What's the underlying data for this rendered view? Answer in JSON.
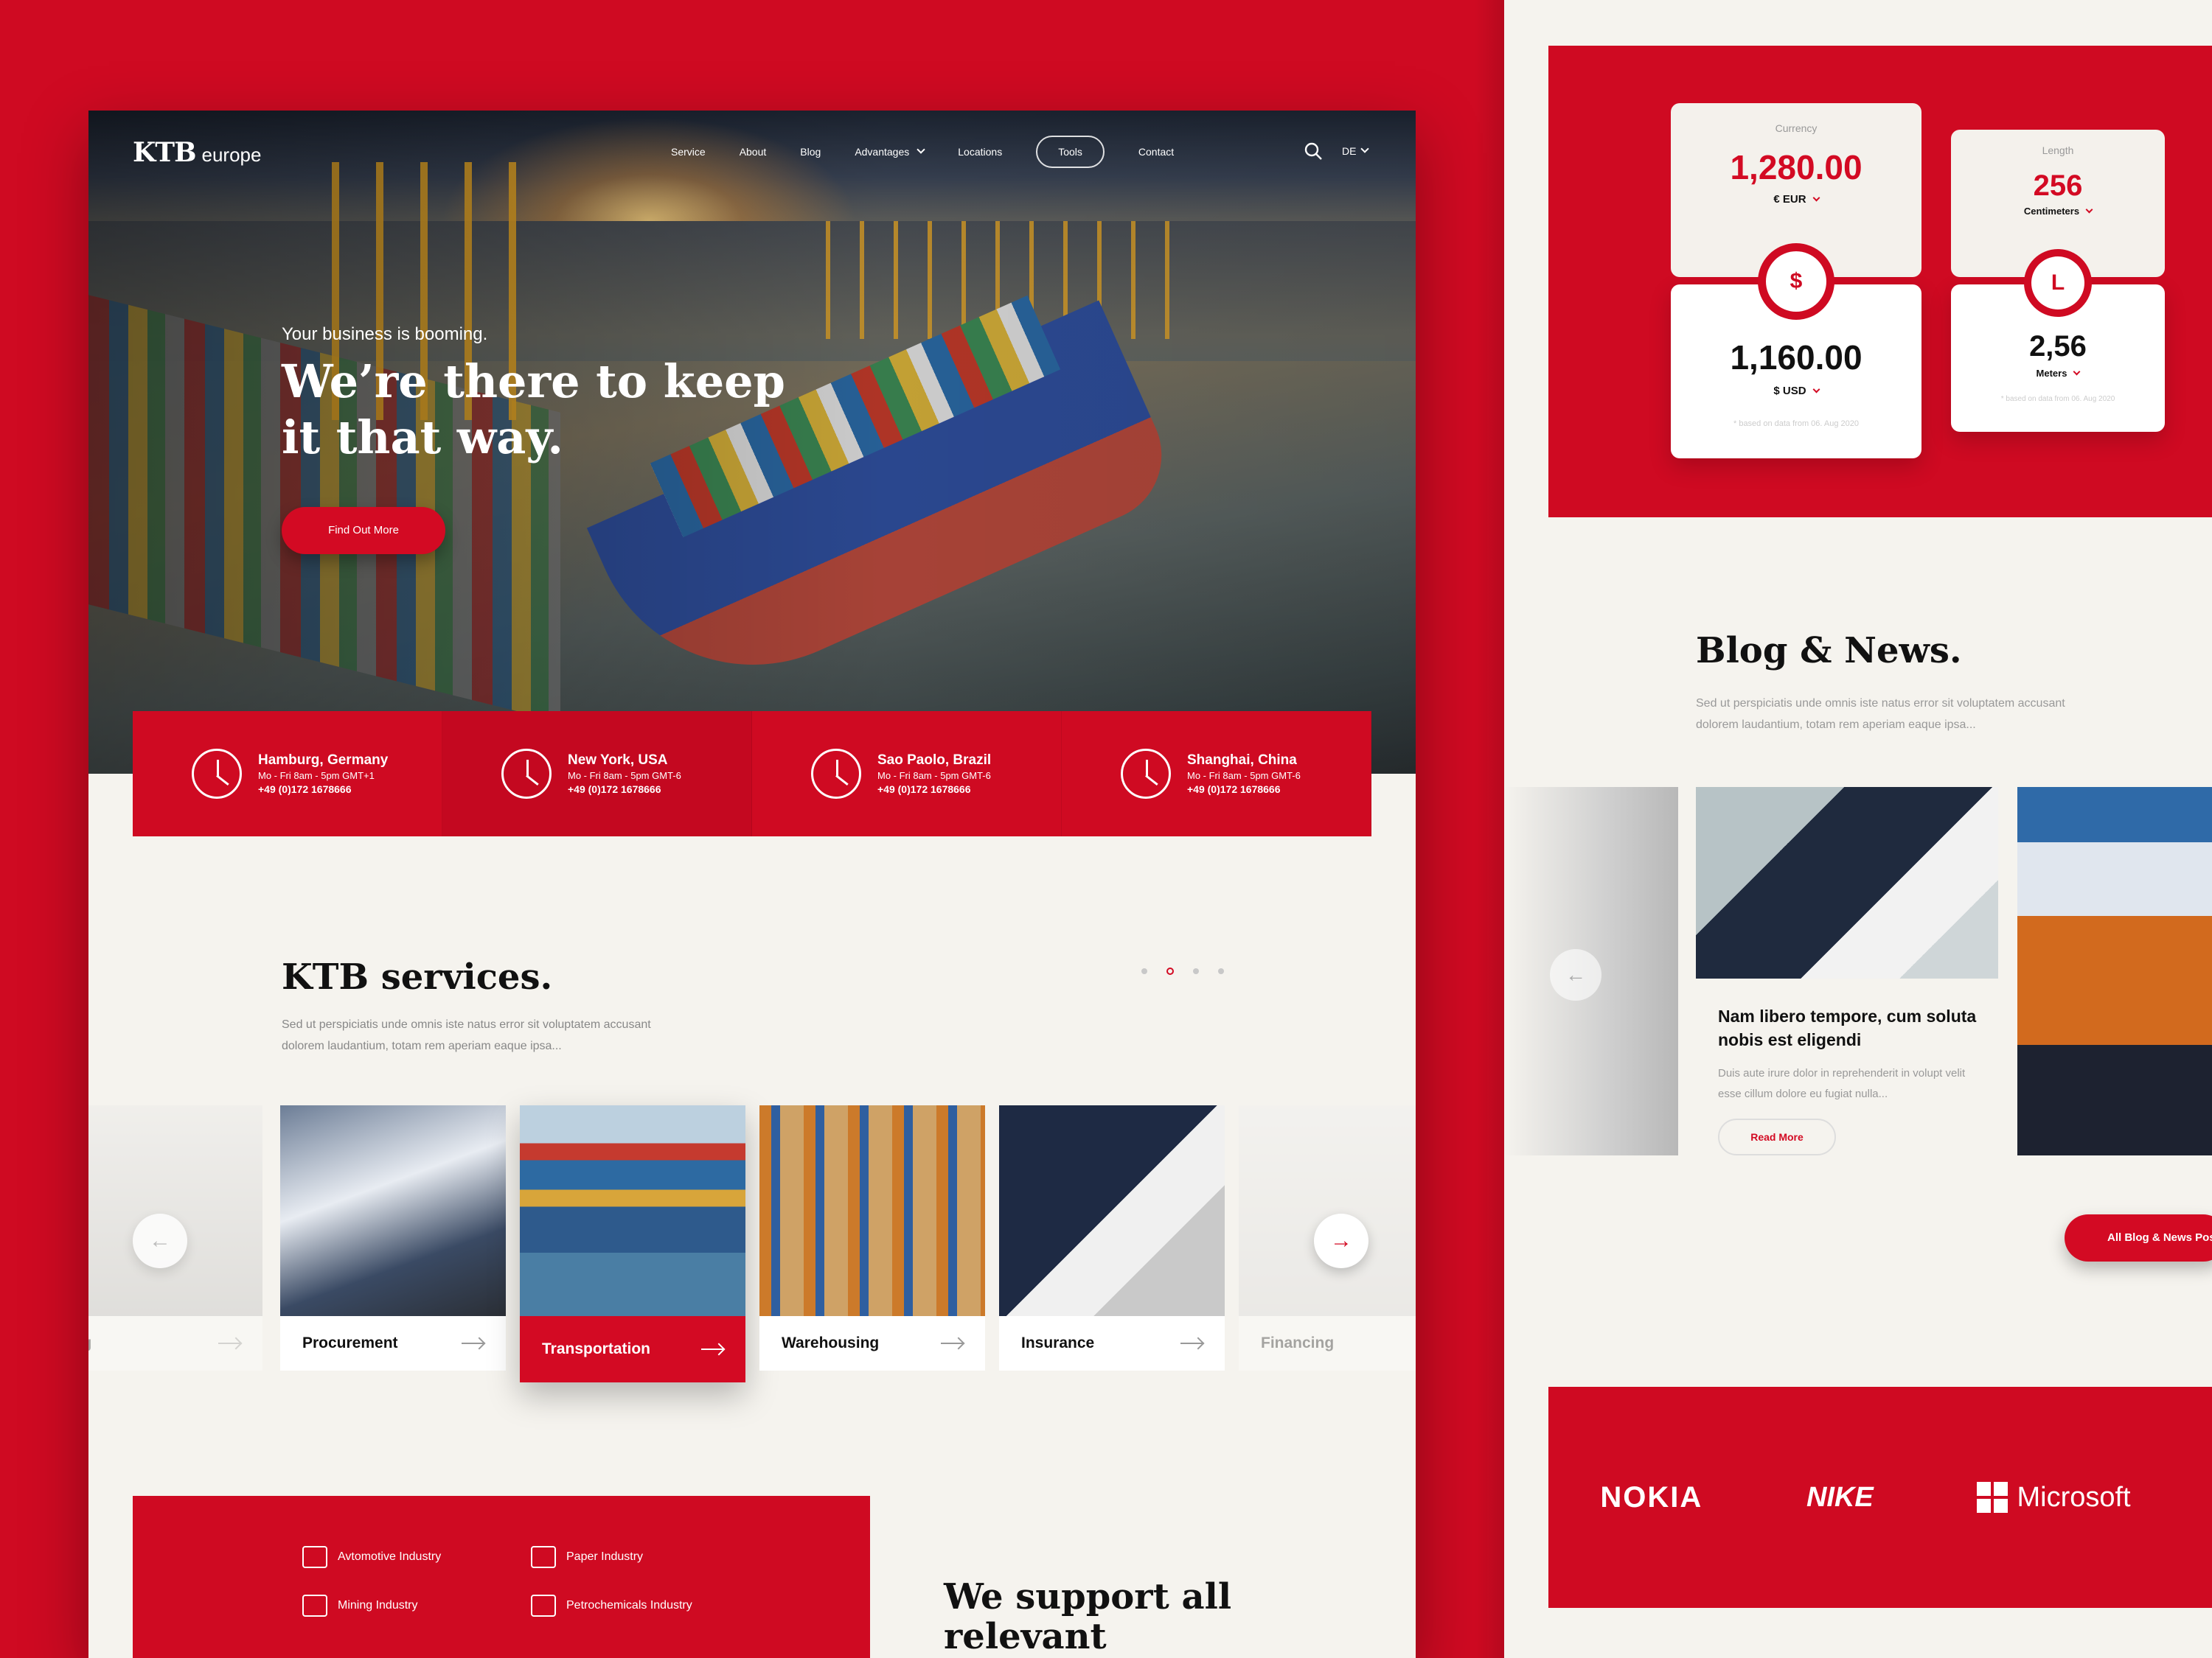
{
  "brand": {
    "mark": "KTB",
    "sub": "europe"
  },
  "nav": {
    "items": [
      "Service",
      "About",
      "Blog",
      "Advantages",
      "Locations",
      "Tools",
      "Contact"
    ],
    "language": "DE"
  },
  "hero": {
    "kicker": "Your business is booming.",
    "title": "We’re there to keep it that way.",
    "cta": "Find Out More"
  },
  "offices": [
    {
      "city": "Hamburg, Germany",
      "hours": "Mo - Fri 8am - 5pm GMT+1",
      "phone": "+49 (0)172 1678666"
    },
    {
      "city": "New York, USA",
      "hours": "Mo - Fri 8am - 5pm GMT-6",
      "phone": "+49 (0)172 1678666"
    },
    {
      "city": "Sao Paolo, Brazil",
      "hours": "Mo - Fri 8am - 5pm GMT-6",
      "phone": "+49 (0)172 1678666"
    },
    {
      "city": "Shanghai, China",
      "hours": "Mo - Fri 8am - 5pm GMT-6",
      "phone": "+49 (0)172 1678666"
    }
  ],
  "services": {
    "title": "KTB services.",
    "desc": "Sed ut perspiciatis unde omnis iste natus error sit voluptatem accusant dolorem laudantium, totam rem aperiam eaque ipsa...",
    "cards": [
      "ding",
      "Procurement",
      "Transportation",
      "Warehousing",
      "Insurance",
      "Financing"
    ],
    "active_index": 2
  },
  "industries": {
    "items": [
      "Avtomotive Industry",
      "Paper Industry",
      "Mining Industry",
      "Petrochemicals Industry"
    ]
  },
  "support": {
    "title": "We support all relevant"
  },
  "tools": {
    "currency": {
      "label": "Currency",
      "from_value": "1,280.00",
      "from_unit": "€ EUR",
      "to_value": "1,160.00",
      "to_unit": "$ USD",
      "note": "* based on data from 06. Aug 2020"
    },
    "length": {
      "label": "Length",
      "from_value": "256",
      "from_unit": "Centimeters",
      "to_value": "2,56",
      "to_unit": "Meters",
      "note": "* based on data from 06. Aug 2020"
    }
  },
  "blog": {
    "title": "Blog & News.",
    "desc": "Sed ut perspiciatis unde omnis iste natus error sit voluptatem accusant dolorem laudantium, totam rem aperiam eaque ipsa...",
    "post_title": "Nam libero tempore, cum soluta nobis est eligendi",
    "post_text": "Duis aute irure dolor in reprehenderit in volupt velit esse cillum dolore eu fugiat nulla...",
    "read_more": "Read More",
    "all_posts": "All Blog & News Posts"
  },
  "brands": [
    "NOKIA",
    "NIKE",
    "Microsoft"
  ],
  "colors": {
    "accent": "#cf0a22",
    "page": "#f5f3ee",
    "text": "#111111"
  }
}
